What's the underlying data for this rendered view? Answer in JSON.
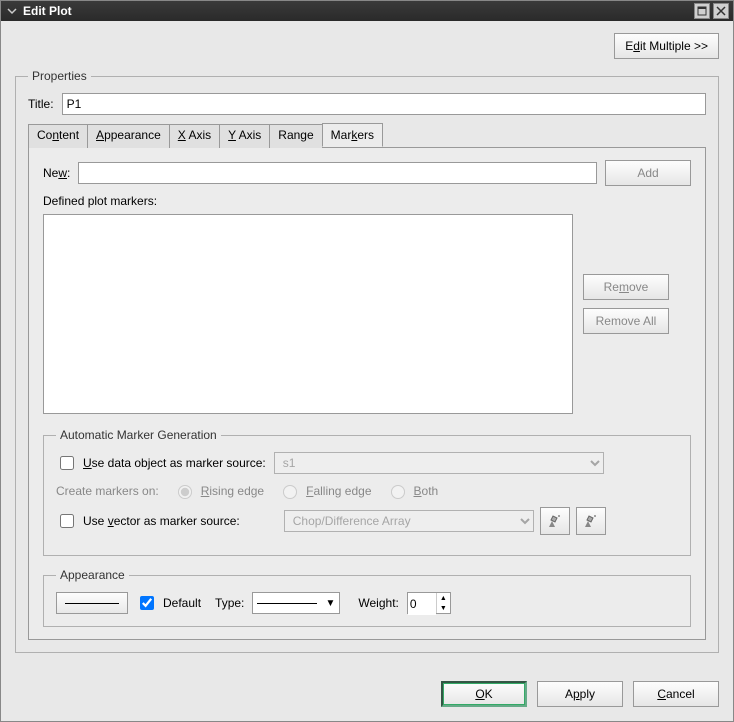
{
  "titlebar": {
    "title": "Edit Plot"
  },
  "toolbar": {
    "edit_multiple": "Edit Multiple >>"
  },
  "properties": {
    "legend": "Properties",
    "title_label": "Title:",
    "title_value": "P1",
    "tabs": {
      "content": "Content",
      "appearance": "Appearance",
      "x_axis": "X Axis",
      "y_axis": "Y Axis",
      "range": "Range",
      "markers": "Markers"
    }
  },
  "markers": {
    "new_label": "New:",
    "new_value": "",
    "add_btn": "Add",
    "defined_label": "Defined plot markers:",
    "remove_btn": "Remove",
    "remove_all_btn": "Remove All"
  },
  "amg": {
    "legend": "Automatic Marker Generation",
    "use_data_object": "Use data object as marker source:",
    "data_object_value": "s1",
    "create_markers_on": "Create markers on:",
    "rising": "Rising edge",
    "falling": "Falling edge",
    "both": "Both",
    "use_vector": "Use vector as marker source:",
    "vector_value": "Chop/Difference Array"
  },
  "appearance": {
    "legend": "Appearance",
    "default": "Default",
    "type_label": "Type:",
    "weight_label": "Weight:",
    "weight_value": "0"
  },
  "footer": {
    "ok": "OK",
    "apply": "Apply",
    "cancel": "Cancel"
  }
}
